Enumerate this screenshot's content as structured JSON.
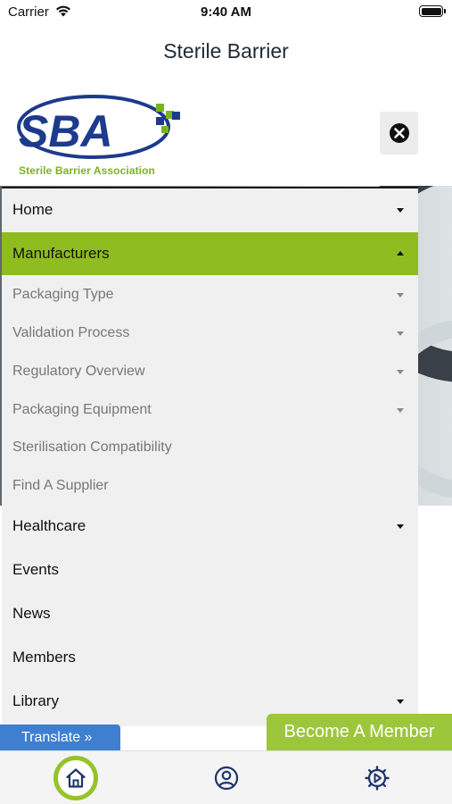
{
  "status_bar": {
    "carrier": "Carrier",
    "time": "9:40 AM",
    "wifi_icon": "wifi-icon",
    "battery_icon": "battery-icon"
  },
  "header": {
    "title": "Sterile Barrier"
  },
  "logo": {
    "wordmark": "SBA",
    "caption": "Sterile Barrier Association",
    "brand_blue": "#1d3a8c",
    "brand_green": "#7ab41d"
  },
  "close_icon": "close-icon",
  "menu": {
    "items": [
      {
        "label": "Home",
        "has_caret": true
      },
      {
        "label": "Manufacturers",
        "has_caret": true,
        "expanded": true
      },
      {
        "label": "Healthcare",
        "has_caret": true
      },
      {
        "label": "Events",
        "has_caret": false
      },
      {
        "label": "News",
        "has_caret": false
      },
      {
        "label": "Members",
        "has_caret": false
      },
      {
        "label": "Library",
        "has_caret": true
      }
    ],
    "submenu": [
      {
        "label": "Packaging Type",
        "has_caret": true
      },
      {
        "label": "Validation Process",
        "has_caret": true
      },
      {
        "label": "Regulatory Overview",
        "has_caret": true
      },
      {
        "label": "Packaging Equipment",
        "has_caret": true
      },
      {
        "label": "Sterilisation Compatibility",
        "has_caret": false
      },
      {
        "label": "Find A Supplier",
        "has_caret": false
      }
    ],
    "active_color": "#8fbc1f"
  },
  "translate": {
    "label": "Translate »"
  },
  "member_cta": {
    "label": "Become A Member"
  },
  "tab_bar": {
    "tabs": [
      {
        "icon": "home-icon",
        "selected": true
      },
      {
        "icon": "user-icon",
        "selected": false
      },
      {
        "icon": "settings-icon",
        "selected": false
      }
    ],
    "accent": "#96c329",
    "icon_color": "#1f3569"
  }
}
